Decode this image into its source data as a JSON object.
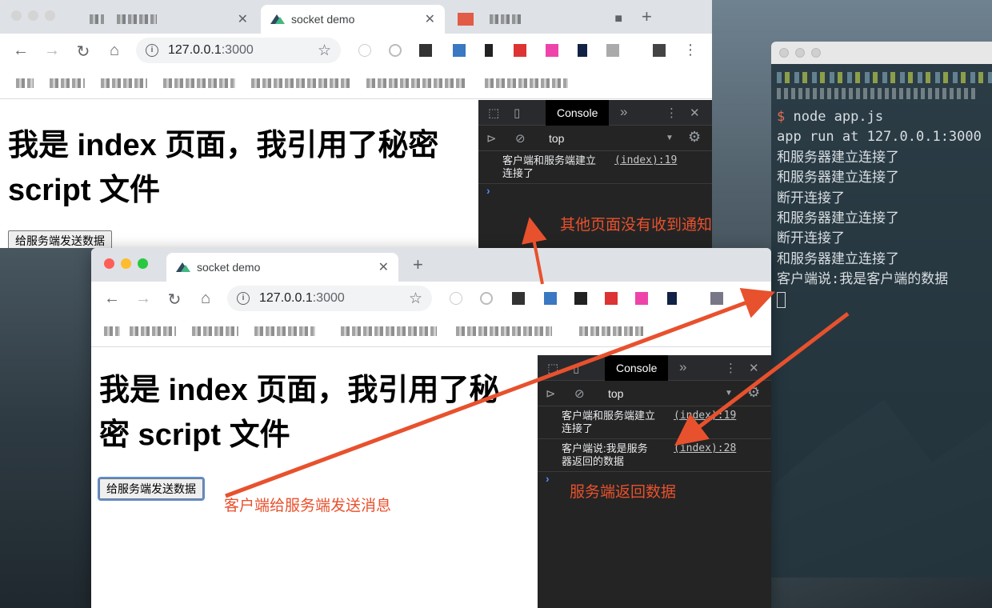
{
  "colors": {
    "annotation": "#e8512d",
    "devtools_bg": "#242424",
    "terminal_prompt": "#e66d52",
    "traffic_red": "#fd5f57",
    "traffic_yellow": "#febc2e",
    "traffic_green": "#28c840"
  },
  "terminal": {
    "prompt_symbol": "$",
    "command": "node app.js",
    "lines": [
      "app run at 127.0.0.1:3000",
      "和服务器建立连接了",
      "和服务器建立连接了",
      "断开连接了",
      "和服务器建立连接了",
      "断开连接了",
      "和服务器建立连接了",
      "客户端说:我是客户端的数据"
    ]
  },
  "browser_back": {
    "tab_title": "socket demo",
    "url_host": "127.0.0.1",
    "url_port": ":3000",
    "heading_line1": "我是 index 页面，我引用了秘密",
    "heading_line2": "script 文件",
    "send_button": "给服务端发送数据",
    "devtools": {
      "console_tab": "Console",
      "more_tabs": "»",
      "context": "top",
      "messages": [
        {
          "text_line1": "客户端和服务端建立",
          "text_line2": "连接了",
          "source": "(index):19"
        }
      ]
    }
  },
  "browser_front": {
    "tab_title": "socket demo",
    "url_host": "127.0.0.1",
    "url_port": ":3000",
    "heading_line1": "我是 index 页面，我引用了秘",
    "heading_line2": "密 script 文件",
    "send_button": "给服务端发送数据",
    "devtools": {
      "console_tab": "Console",
      "more_tabs": "»",
      "context": "top",
      "messages": [
        {
          "text_line1": "客户端和服务端建立",
          "text_line2": "连接了",
          "source": "(index):19"
        },
        {
          "text_line1": "客户端说:我是服务",
          "text_line2": "器返回的数据",
          "source": "(index):28"
        }
      ]
    }
  },
  "annotations": {
    "other_page": "其他页面没有收到通知",
    "client_send": "客户端给服务端发送消息",
    "server_return": "服务端返回数据"
  }
}
